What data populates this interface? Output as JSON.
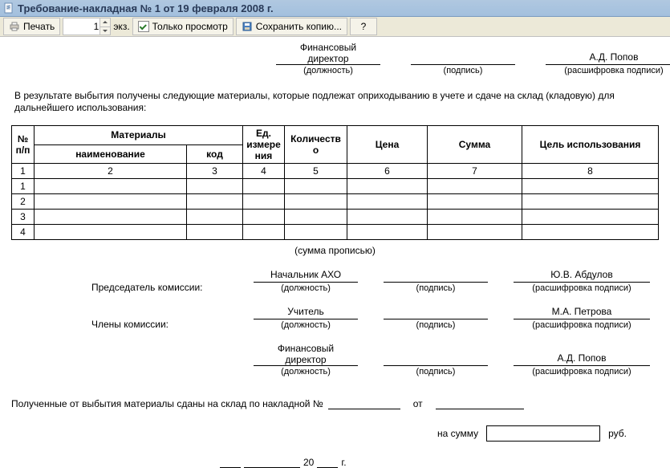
{
  "window": {
    "title": "Требование-накладная № 1 от 19 февраля 2008 г."
  },
  "toolbar": {
    "print_label": "Печать",
    "copies_value": "1",
    "copies_suffix": "экз.",
    "readonly_label": "Только просмотр",
    "save_copy_label": "Сохранить копию...",
    "help_label": "?"
  },
  "header_sig": {
    "position_value": "Финансовый\nдиректор",
    "position_caption": "(должность)",
    "sign_caption": "(подпись)",
    "name_value": "А.Д. Попов",
    "name_caption": "(расшифровка подписи)"
  },
  "para": "В результате выбытия получены следующие материалы, которые подлежат оприходыванию в учете и сдаче на склад (кладовую) для дальнейшего использования:",
  "table": {
    "headers": {
      "num": "№\nп/п",
      "materials": "Материалы",
      "materials_name": "наименование",
      "materials_code": "код",
      "unit": "Ед.\nизмере\nния",
      "qty": "Количеств\nо",
      "price": "Цена",
      "sum": "Сумма",
      "purpose": "Цель использования"
    },
    "colnums": {
      "c1": "1",
      "c2": "2",
      "c3": "3",
      "c4": "4",
      "c5": "5",
      "c6": "6",
      "c7": "7",
      "c8": "8"
    },
    "rows": [
      "1",
      "2",
      "3",
      "4"
    ]
  },
  "sum_in_words_caption": "(сумма прописью)",
  "committee": {
    "chairman_label": "Председатель комиссии:",
    "members_label": "Члены комиссии:",
    "rows": [
      {
        "position": "Начальник АХО",
        "name": "Ю.В. Абдулов"
      },
      {
        "position": "Учитель",
        "name": "М.А. Петрова"
      },
      {
        "position": "Финансовый\nдиректор",
        "name": "А.Д. Попов"
      }
    ],
    "position_caption": "(должность)",
    "sign_caption": "(подпись)",
    "name_caption": "(расшифровка подписи)"
  },
  "handover": {
    "text": "Полученные от выбытия материалы сданы на склад по накладной №",
    "from": "от"
  },
  "totals": {
    "sum_label": "на сумму",
    "currency": "руб."
  },
  "date": {
    "year_prefix": "20",
    "year_suffix": "г."
  }
}
